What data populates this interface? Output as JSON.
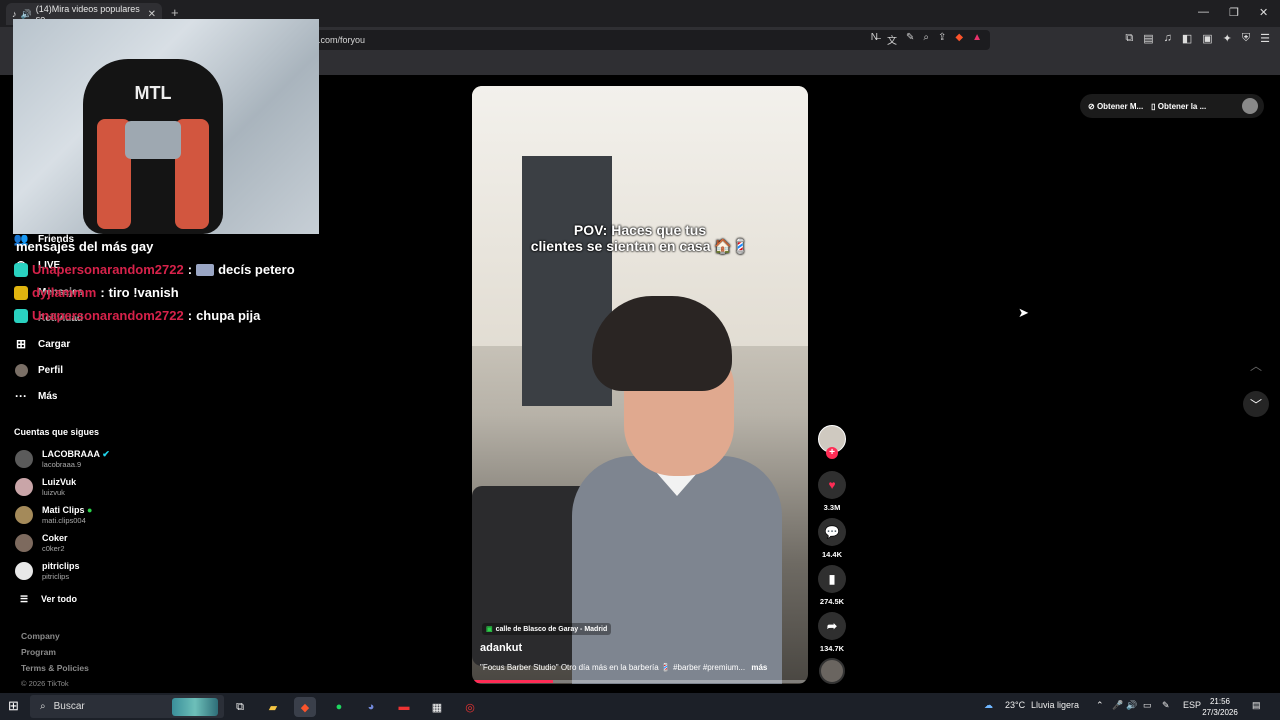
{
  "browser": {
    "tab_title": "(14)Mira videos populares se",
    "tab_close": "✕",
    "new_tab": "+",
    "url": ".com/foryou",
    "window_controls": [
      "—",
      "❐",
      "✕"
    ]
  },
  "sidebar": {
    "items": [
      {
        "label": "Friends",
        "icon": "friends-icon"
      },
      {
        "label": "LIVE",
        "icon": "live-icon"
      },
      {
        "label": "Mensajes",
        "icon": "messages-icon"
      },
      {
        "label": "Actividad",
        "icon": "activity-icon"
      },
      {
        "label": "Cargar",
        "icon": "upload-icon",
        "glyph": "⊞"
      },
      {
        "label": "Perfil",
        "icon": "profile-icon"
      },
      {
        "label": "Más",
        "icon": "more-icon",
        "glyph": "···"
      }
    ],
    "following_title": "Cuentas que sigues",
    "following": [
      {
        "name": "LACOBRAAA",
        "handle": "lacobraaa.9",
        "badge": "verified"
      },
      {
        "name": "LuizVuk",
        "handle": "luizvuk"
      },
      {
        "name": "Mati Clips",
        "handle": "mati.clips004",
        "badge": "live"
      },
      {
        "name": "Coker",
        "handle": "c0ker2"
      },
      {
        "name": "pitriclips",
        "handle": "pitriclips"
      }
    ],
    "see_all": "Ver todo",
    "footer": [
      "Company",
      "Program",
      "Terms & Policies",
      "© 2026 TikTok"
    ]
  },
  "webcam": {
    "logo_text": "MTL"
  },
  "chat": {
    "title": "mensajes del más gay",
    "lines": [
      {
        "user": "Unapersonarandom2722",
        "sep": ":",
        "message": "decís petero",
        "badge_color": "#2ad1c0"
      },
      {
        "user": "dyjlammm",
        "sep": ":",
        "message": "tiro !vanish",
        "badge_color": "#e0b40f"
      },
      {
        "user": "Unapersonarandom2722",
        "sep": ":",
        "message": "chupa pija",
        "badge_color": "#2ad1c0"
      }
    ]
  },
  "video": {
    "overlay_text_line1": "POV: Haces que tus",
    "overlay_text_line2": "clientes se sientan en casa 🏠💈",
    "location": "calle de Blasco de Garay - Madrid",
    "author": "adankut",
    "caption": "\"Focus Barber Studio\"  Otro día más en la barbería 💈 #barber #premium...",
    "more": "más",
    "progress": 0.24
  },
  "actions": {
    "likes": "3.3M",
    "comments": "14.4K",
    "saves": "274.5K",
    "shares": "134.7K"
  },
  "top_right": {
    "get_app_1": "Obtener M...",
    "get_app_2": "Obtener la ..."
  },
  "taskbar": {
    "search_placeholder": "Buscar",
    "temperature": "23°C",
    "weather": "Lluvia ligera",
    "language": "ESP",
    "time": "21:56",
    "date": "27/3/2026"
  },
  "colors": {
    "accent": "#fe2c55",
    "chat_username": "#d6224a",
    "background": "#000000"
  }
}
